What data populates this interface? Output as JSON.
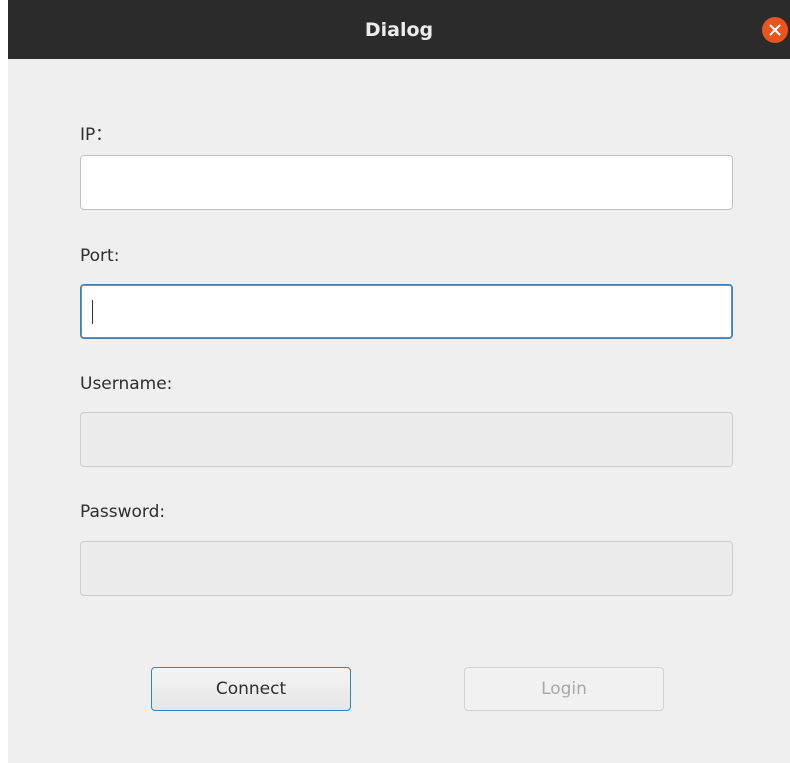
{
  "window": {
    "title": "Dialog"
  },
  "form": {
    "ip_label": "IP：",
    "ip_value": "",
    "port_label": "Port:",
    "port_value": "",
    "username_label": "Username:",
    "username_value": "",
    "password_label": "Password:",
    "password_value": ""
  },
  "buttons": {
    "connect_label": "Connect",
    "login_label": "Login"
  },
  "icons": {
    "close": "close-icon"
  },
  "colors": {
    "titlebar": "#2b2b2b",
    "close_button": "#e9541f",
    "focus_border": "#3f7fb8"
  }
}
